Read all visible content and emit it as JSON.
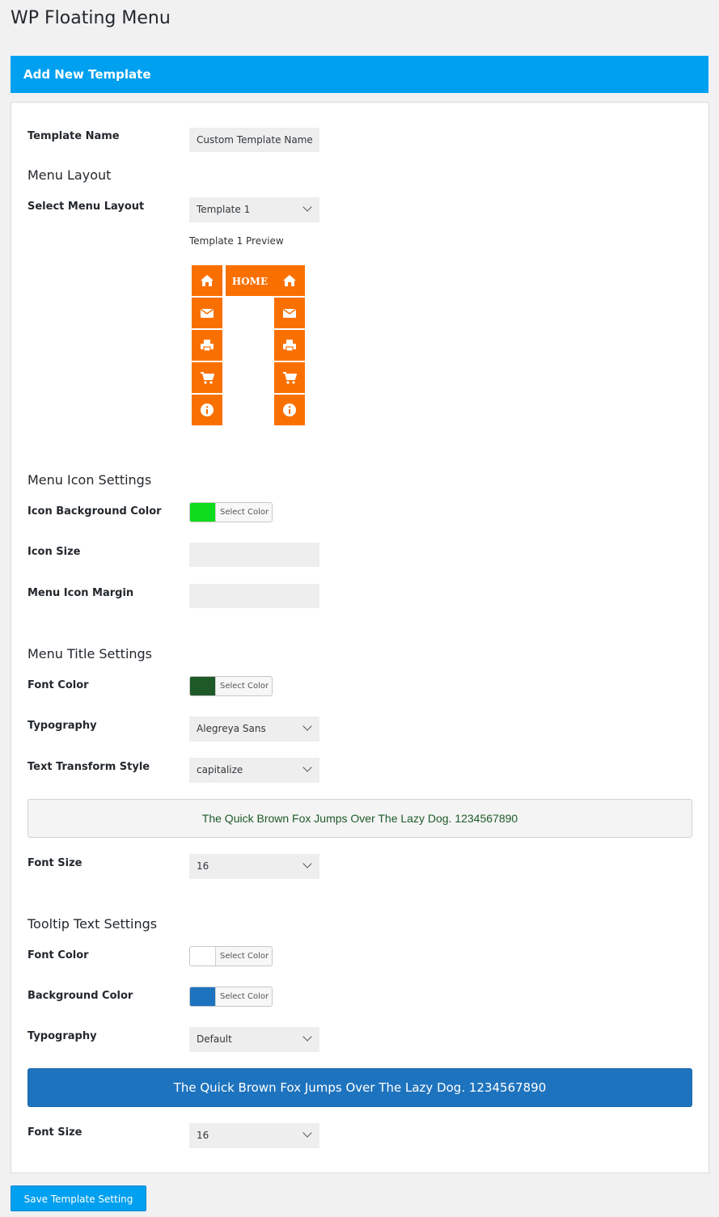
{
  "page": {
    "title": "WP Floating Menu"
  },
  "header": {
    "title": "Add New Template"
  },
  "template_name": {
    "label": "Template Name",
    "value": "Custom Template Name"
  },
  "menu_layout": {
    "section": "Menu Layout",
    "label": "Select Menu Layout",
    "selected": "Template 1",
    "preview_label": "Template 1 Preview",
    "home_text": "HOME",
    "tile_color": "#fa7000",
    "icons": [
      "home-icon",
      "envelope-icon",
      "print-icon",
      "cart-icon",
      "info-icon"
    ]
  },
  "icon_settings": {
    "section": "Menu Icon Settings",
    "bg_color_label": "Icon Background Color",
    "bg_color": "#0fdc1c",
    "select_color": "Select Color",
    "icon_size_label": "Icon Size",
    "icon_size_value": "",
    "margin_label": "Menu Icon Margin",
    "margin_value": ""
  },
  "title_settings": {
    "section": "Menu Title Settings",
    "font_color_label": "Font Color",
    "font_color": "#1e5a28",
    "select_color": "Select Color",
    "typography_label": "Typography",
    "typography": "Alegreya Sans",
    "transform_label": "Text Transform Style",
    "transform": "capitalize",
    "sample": "The Quick Brown Fox Jumps Over The Lazy Dog. 1234567890",
    "font_size_label": "Font Size",
    "font_size": "16"
  },
  "tooltip_settings": {
    "section": "Tooltip Text Settings",
    "font_color_label": "Font Color",
    "font_color": "#ffffff",
    "bg_color_label": "Background Color",
    "bg_color": "#1e73be",
    "select_color": "Select Color",
    "typography_label": "Typography",
    "typography": "Default",
    "sample": "The Quick Brown Fox Jumps Over The Lazy Dog. 1234567890",
    "font_size_label": "Font Size",
    "font_size": "16"
  },
  "save_button": {
    "label": "Save Template Setting"
  }
}
